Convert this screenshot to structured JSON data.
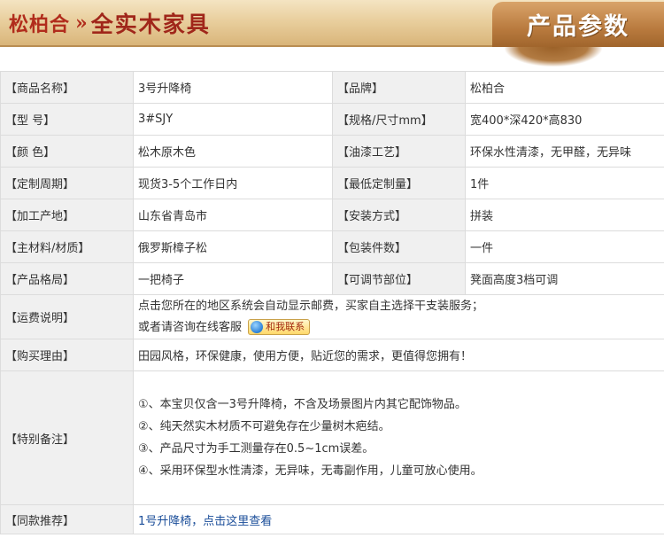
{
  "header": {
    "brand_logo": "松柏合",
    "separator": "»",
    "slogan": "全实木家具",
    "tab_title": "产品参数"
  },
  "specs": [
    {
      "label1": "【商品名称】",
      "value1": "3号升降椅",
      "label2": "【品牌】",
      "value2": "松柏合"
    },
    {
      "label1": "【型 号】",
      "value1": "3#SJY",
      "label2": "【规格/尺寸mm】",
      "value2": "宽400*深420*高830"
    },
    {
      "label1": "【颜 色】",
      "value1": "松木原木色",
      "label2": "【油漆工艺】",
      "value2": "环保水性清漆，无甲醛，无异味"
    },
    {
      "label1": "【定制周期】",
      "value1": "现货3-5个工作日内",
      "label2": "【最低定制量】",
      "value2": "1件"
    },
    {
      "label1": "【加工产地】",
      "value1": "山东省青岛市",
      "label2": "【安装方式】",
      "value2": "拼装"
    },
    {
      "label1": "【主材料/材质】",
      "value1": "俄罗斯樟子松",
      "label2": "【包装件数】",
      "value2": "一件"
    },
    {
      "label1": "【产品格局】",
      "value1": "一把椅子",
      "label2": "【可调节部位】",
      "value2": "凳面高度3档可调"
    }
  ],
  "shipping": {
    "label": "【运费说明】",
    "line1": "点击您所在的地区系统会自动显示邮费，买家自主选择干支装服务；",
    "line2": "或者请咨询在线客服",
    "contact_label": "和我联系"
  },
  "reason": {
    "label": "【购买理由】",
    "text": "田园风格，环保健康，使用方便，贴近您的需求，更值得您拥有！"
  },
  "notes": {
    "label": "【特别备注】",
    "items": [
      "①、本宝贝仅含一3号升降椅，不含及场景图片内其它配饰物品。",
      "②、纯天然实木材质不可避免存在少量树木疤结。",
      "③、产品尺寸为手工测量存在0.5~1cm误差。",
      "④、采用环保型水性清漆，无异味，无毒副作用，儿童可放心使用。"
    ]
  },
  "recommend": {
    "label": "【同款推荐】",
    "link": "1号升降椅，点击这里查看"
  },
  "colors": {
    "label_bg": "#f0f0f0",
    "border": "#dcdcdc",
    "brand_red": "#b12c1c",
    "tab_brown": "#b97a3e",
    "link_blue": "#1a4d99"
  }
}
